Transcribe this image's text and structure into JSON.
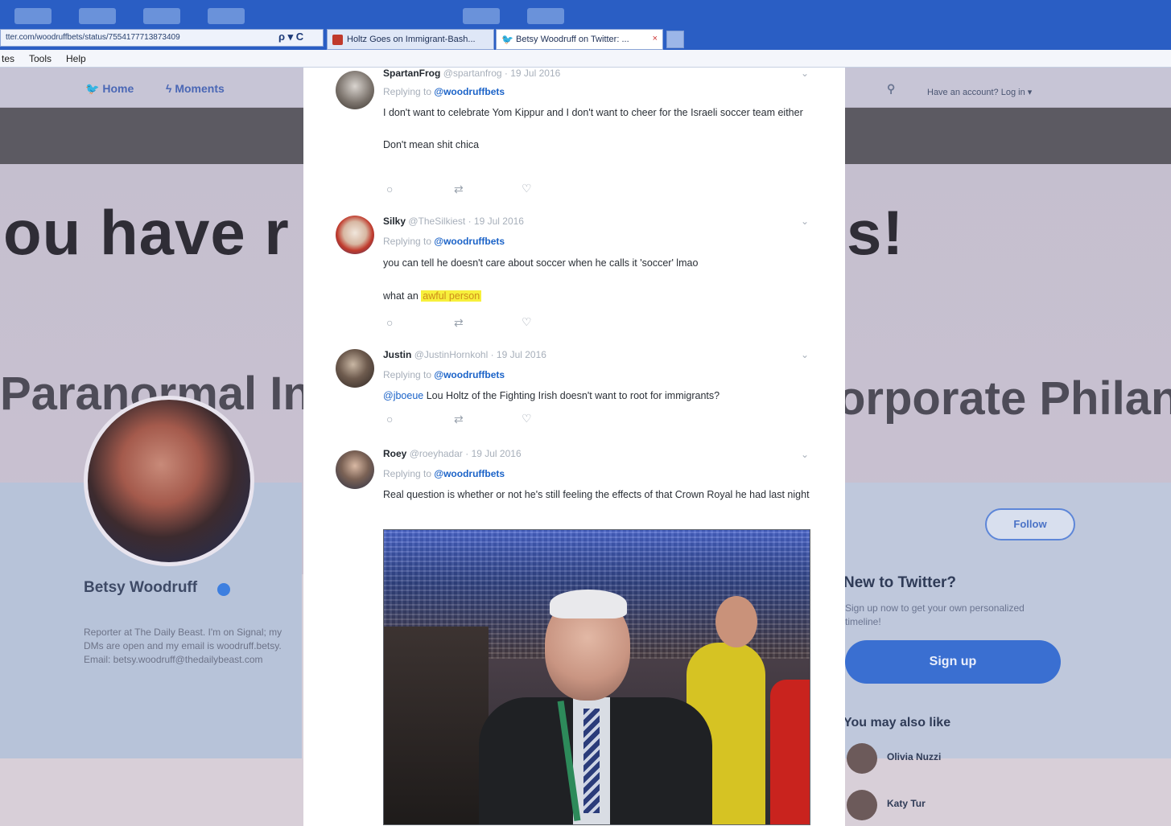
{
  "browser": {
    "address": "tter.com/woodruffbets/status/7554177713873409",
    "address_controls": "ρ ▾ C",
    "tabs": [
      {
        "label": "Holtz Goes on Immigrant-Bash..."
      },
      {
        "label": "Betsy Woodruff on Twitter: ..."
      }
    ],
    "tab_close": "×",
    "menu": [
      "tes",
      "Tools",
      "Help"
    ]
  },
  "background_page": {
    "nav": {
      "home": "Home",
      "moments": "Moments"
    },
    "login_prompt": "Have an account? Log in ▾",
    "banner_text_left": "ou have r",
    "banner_text_right": "s!",
    "banner_sub_left": "Paranormal Inv",
    "banner_sub_right": "orporate Philant",
    "profile": {
      "name": "Betsy Woodruff",
      "bio": "Reporter at The Daily Beast. I'm on Signal; my DMs are open and my email is woodruff.betsy. Email: betsy.woodruff@thedailybeast.com"
    },
    "follow_button": "Follow",
    "new_to_twitter": "New to Twitter?",
    "new_to_twitter_sub": "Sign up now to get your own personalized timeline!",
    "signup_button": "Sign up",
    "you_may_also_like": "You may also like",
    "suggestions": [
      "Olivia Nuzzi",
      "Katy Tur"
    ]
  },
  "replies": [
    {
      "name": "SpartanFrog",
      "meta": "@spartanfrog · 19 Jul 2016",
      "replying_prefix": "Replying to",
      "replying_to": "@woodruffbets",
      "body": [
        "I don't want to celebrate Yom Kippur  and I don't want to cheer for the Israeli soccer team either",
        "Don't mean shit chica"
      ]
    },
    {
      "name": "Silky",
      "meta": "@TheSilkiest · 19 Jul 2016",
      "replying_prefix": "Replying to",
      "replying_to": "@woodruffbets",
      "body_line1": "you can tell he doesn't care about soccer when he calls it 'soccer' lmao",
      "body_line2_prefix": "what an ",
      "body_line2_highlight": "awful person"
    },
    {
      "name": "Justin",
      "meta": "@JustinHornkohl · 19 Jul 2016",
      "replying_prefix": "Replying to",
      "replying_to": "@woodruffbets",
      "body_mention": "@jboeue",
      "body_rest": " Lou Holtz of the Fighting Irish doesn't want to root for immigrants?"
    },
    {
      "name": "Roey",
      "meta": "@roeyhadar · 19 Jul 2016",
      "replying_prefix": "Replying to",
      "replying_to": "@woodruffbets",
      "body": "Real question is whether or not he's still feeling the effects of that Crown Royal he had last night"
    }
  ],
  "actions": {
    "reply_icon": "○",
    "retweet_icon": "⇄",
    "like_icon": "♡",
    "caret_icon": "⌄"
  },
  "colors": {
    "twitter_blue": "#1b63c8",
    "highlight": "#f7f03c",
    "chrome_blue": "#2a5ec4"
  }
}
